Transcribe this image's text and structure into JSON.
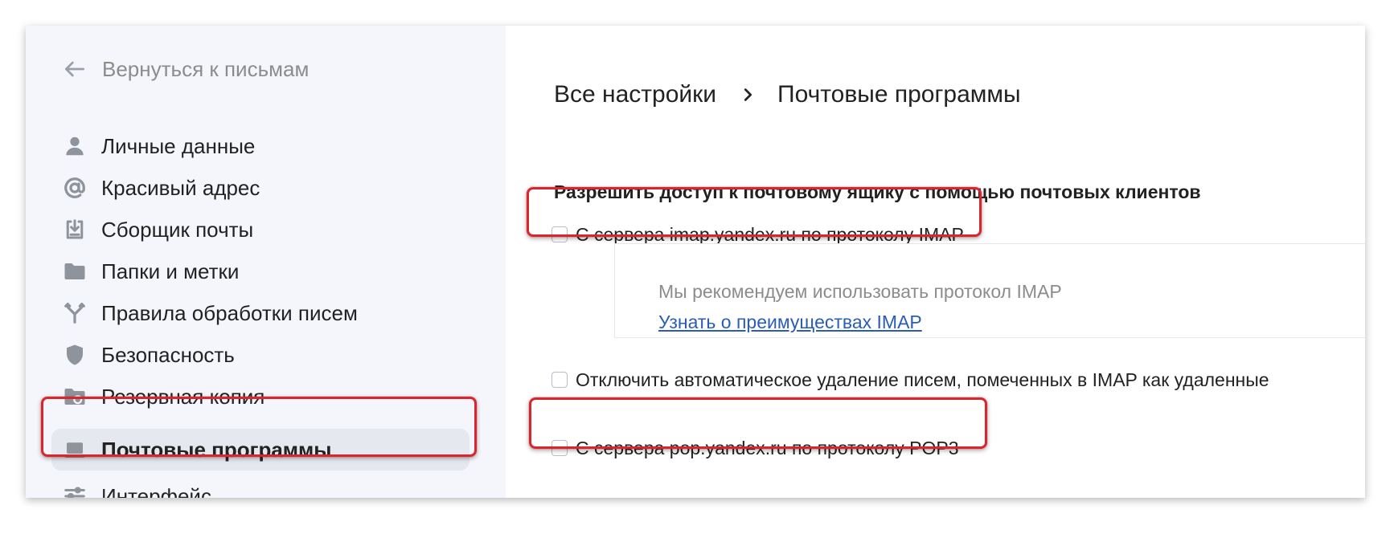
{
  "sidebar": {
    "back_label": "Вернуться к письмам",
    "items": [
      {
        "label": "Личные данные",
        "icon": "person-icon"
      },
      {
        "label": "Красивый адрес",
        "icon": "at-sign-icon"
      },
      {
        "label": "Сборщик почты",
        "icon": "inbox-download-icon"
      },
      {
        "label": "Папки и метки",
        "icon": "folder-icon"
      },
      {
        "label": "Правила обработки писем",
        "icon": "fork-rules-icon"
      },
      {
        "label": "Безопасность",
        "icon": "shield-icon"
      },
      {
        "label": "Резервная копия",
        "icon": "folder-backup-icon"
      },
      {
        "label": "Почтовые программы",
        "icon": "laptop-icon",
        "active": true
      },
      {
        "label": "Интерфейс",
        "icon": "sliders-icon"
      }
    ]
  },
  "breadcrumb": {
    "root": "Все настройки",
    "current": "Почтовые программы"
  },
  "main": {
    "section_title": "Разрешить доступ к почтовому ящику с помощью почтовых клиентов",
    "imap_option": {
      "label": "С сервера imap.yandex.ru по протоколу IMAP",
      "checked": false
    },
    "hint": {
      "text": "Мы рекомендуем использовать протокол IMAP",
      "link": "Узнать о преимуществах IMAP"
    },
    "autodelete_option": {
      "label": "Отключить автоматическое удаление писем, помеченных в IMAP как удаленные",
      "checked": false
    },
    "pop3_option": {
      "label": "С сервера pop.yandex.ru по протоколу POP3",
      "checked": false
    }
  },
  "colors": {
    "sidebar_bg": "#f4f6fb",
    "active_item_bg": "#e5e8ef",
    "link": "#2b5db5",
    "annotation": "#d7262e",
    "muted_text": "#8c8c8c"
  }
}
